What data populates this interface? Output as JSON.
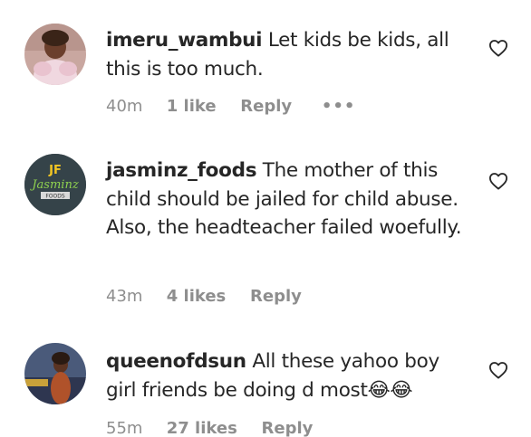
{
  "comments": [
    {
      "username": "imeru_wambui",
      "text": "Let kids be kids, all this is too much.",
      "time": "40m",
      "likes": "1 like",
      "reply": "Reply",
      "more": "•••",
      "avatar_icon": "profile-photo"
    },
    {
      "username": "jasminz_foods",
      "text": "The mother of this child should be jailed for child abuse. Also, the headteacher failed woefully.",
      "time": "43m",
      "likes": "4 likes",
      "reply": "Reply",
      "avatar_icon": "jasminz-foods-logo",
      "avatar_text": "Jasminz",
      "avatar_subtext": "FOODS"
    },
    {
      "username": "queenofdsun",
      "text": "All these yahoo boy girl friends be doing d most😂😂",
      "time": "55m",
      "likes": "27 likes",
      "reply": "Reply",
      "avatar_icon": "profile-photo"
    }
  ],
  "icons": {
    "like": "heart-outline-icon"
  },
  "colors": {
    "text": "#262626",
    "meta": "#8e8e8e",
    "background": "#ffffff"
  }
}
